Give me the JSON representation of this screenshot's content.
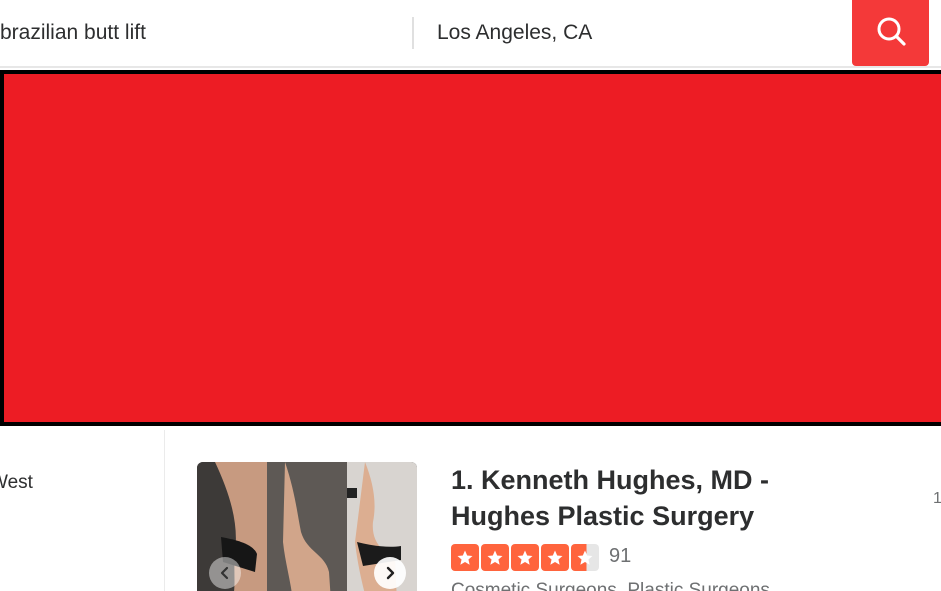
{
  "search": {
    "find_value": "brazilian butt lift",
    "near_value": "Los Angeles, CA"
  },
  "icons": {
    "search": "search-icon",
    "prev": "chevron-left-icon",
    "next": "chevron-right-icon",
    "star": "star-icon"
  },
  "colors": {
    "accent": "#f43939",
    "ad_fill": "#ed1c24",
    "ad_border": "#000000",
    "star": "#ff643d"
  },
  "sidebar": {
    "filter_label": "West"
  },
  "result": {
    "title": "1. Kenneth Hughes, MD - Hughes Plastic Surgery",
    "rating": 4.5,
    "review_count": "91",
    "categories": "Cosmetic Surgeons, Plastic Surgeons",
    "edge_text": "1"
  }
}
